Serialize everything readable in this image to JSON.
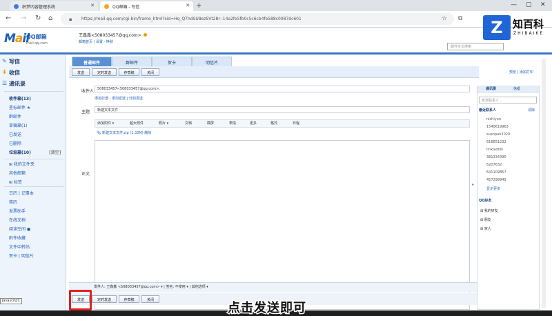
{
  "browser": {
    "tabs": [
      {
        "label": "织梦内容管理系统",
        "active": false
      },
      {
        "label": "QQ邮箱 - 写信",
        "active": true
      }
    ],
    "url": "https://mail.qq.com/cgi-bin/frame_html?sid=Hq_Q7hdSU8ezSVt28r--14a2fe5fb0c5c6cb4fe588c0087dc601"
  },
  "header": {
    "logo_main": "M",
    "logo_o": "a",
    "logo_rest": "il",
    "logo_cn": "QQ邮箱",
    "logo_url": "mail.qq.com",
    "user": "王鑫鑫<508033457@qq.com>",
    "user_links": "邮箱首页 | 设置 - 换肤",
    "search_placeholder": "邮件全文搜索"
  },
  "sidebar": {
    "write": "写信",
    "inbox": "收信",
    "contacts": "通讯录",
    "items": [
      {
        "label": "收件箱(13)",
        "bold": true
      },
      {
        "label": "星标邮件 ★",
        "bold": false
      },
      {
        "label": "群邮件",
        "bold": false
      },
      {
        "label": "草稿箱(1)",
        "bold": false
      },
      {
        "label": "已发送",
        "bold": false
      },
      {
        "label": "已删除",
        "bold": false
      },
      {
        "label": "垃圾箱(10)",
        "bold": true,
        "right": "[清空]"
      },
      {
        "label": "⊞ 我的文件夹",
        "bold": false
      },
      {
        "label": "其他邮箱",
        "bold": false
      },
      {
        "label": "⊞ 标签",
        "bold": false
      },
      {
        "label": "日历 | 记事本",
        "bold": false
      },
      {
        "label": "简历",
        "bold": false
      },
      {
        "label": "发票助手",
        "bold": false
      },
      {
        "label": "在线文档",
        "bold": false
      },
      {
        "label": "阅读空间 ●",
        "bold": false
      },
      {
        "label": "附件收藏",
        "bold": false
      },
      {
        "label": "文件中转站",
        "bold": false
      },
      {
        "label": "贺卡 | 明信片",
        "bold": false
      }
    ]
  },
  "compose": {
    "tabs": [
      "普通邮件",
      "群邮件",
      "贺卡",
      "明信片"
    ],
    "toolbar": [
      "发送",
      "定时发送",
      "存草稿",
      "关闭"
    ],
    "right_links": "预览 | 添加打印",
    "to_label": "收件人",
    "to_value": "508033457<508033457@qq.com>;",
    "to_links": "添加抄送 - 添加密送 | 分别发送",
    "subject_label": "主题",
    "subject_value": "新建文本文件",
    "body_label": "正文",
    "editor_tools": [
      "添加附件 ▾",
      "超大附件",
      "照片 ▾",
      "文档",
      "截屏",
      "表情",
      "更多",
      "格式",
      "日程"
    ],
    "attachment": "新建文本文件.zip (1.32M) 删除",
    "footer_info": "发件人: 王鑫鑫 <508033457@qq.com> ▾ | 签名: 不使用 ▾ | 其他选项 ▾",
    "footer_buttons": [
      "发送",
      "定时发送",
      "存草稿",
      "关闭"
    ]
  },
  "right_panel": {
    "tabs": [
      "通讯录",
      "信纸"
    ],
    "search_placeholder": "查找联系人...",
    "recent_title": "最近联系人",
    "recent_clear": "清除",
    "contacts": [
      "nishiyun",
      "1540619963",
      "suanpan2020",
      "616851232",
      "linxiaobin",
      "381334390",
      "6207632",
      "641109857",
      "457299949"
    ],
    "more": "显示更多",
    "qq_title": "QQ好友",
    "groups": [
      "⊞ 我的好友",
      "⊞ 朋友",
      "⊞ 家人"
    ]
  },
  "overlay": {
    "brand_letter": "Z",
    "brand_cn": "知百科",
    "brand_en": "ZHIBAIKE",
    "tooltip": "javascript:",
    "caption": "点击发送即可"
  }
}
